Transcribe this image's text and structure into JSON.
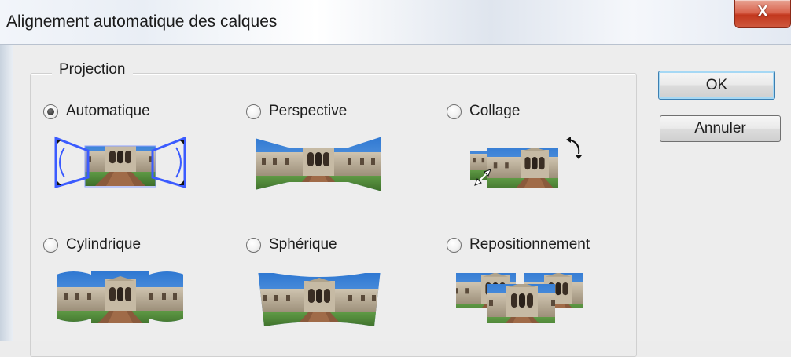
{
  "window": {
    "title": "Alignement automatique des calques",
    "close_label": "X"
  },
  "projection": {
    "group_label": "Projection",
    "options": [
      {
        "label": "Automatique",
        "selected": true
      },
      {
        "label": "Perspective",
        "selected": false
      },
      {
        "label": "Collage",
        "selected": false
      },
      {
        "label": "Cylindrique",
        "selected": false
      },
      {
        "label": "Sphérique",
        "selected": false
      },
      {
        "label": "Repositionnement",
        "selected": false
      }
    ]
  },
  "buttons": {
    "ok": "OK",
    "cancel": "Annuler"
  },
  "colors": {
    "sky": "#3f86d8",
    "building": "#b7ab96",
    "grass": "#4f8a38",
    "path": "#8a5a3c",
    "outline": "#3b5bff"
  }
}
